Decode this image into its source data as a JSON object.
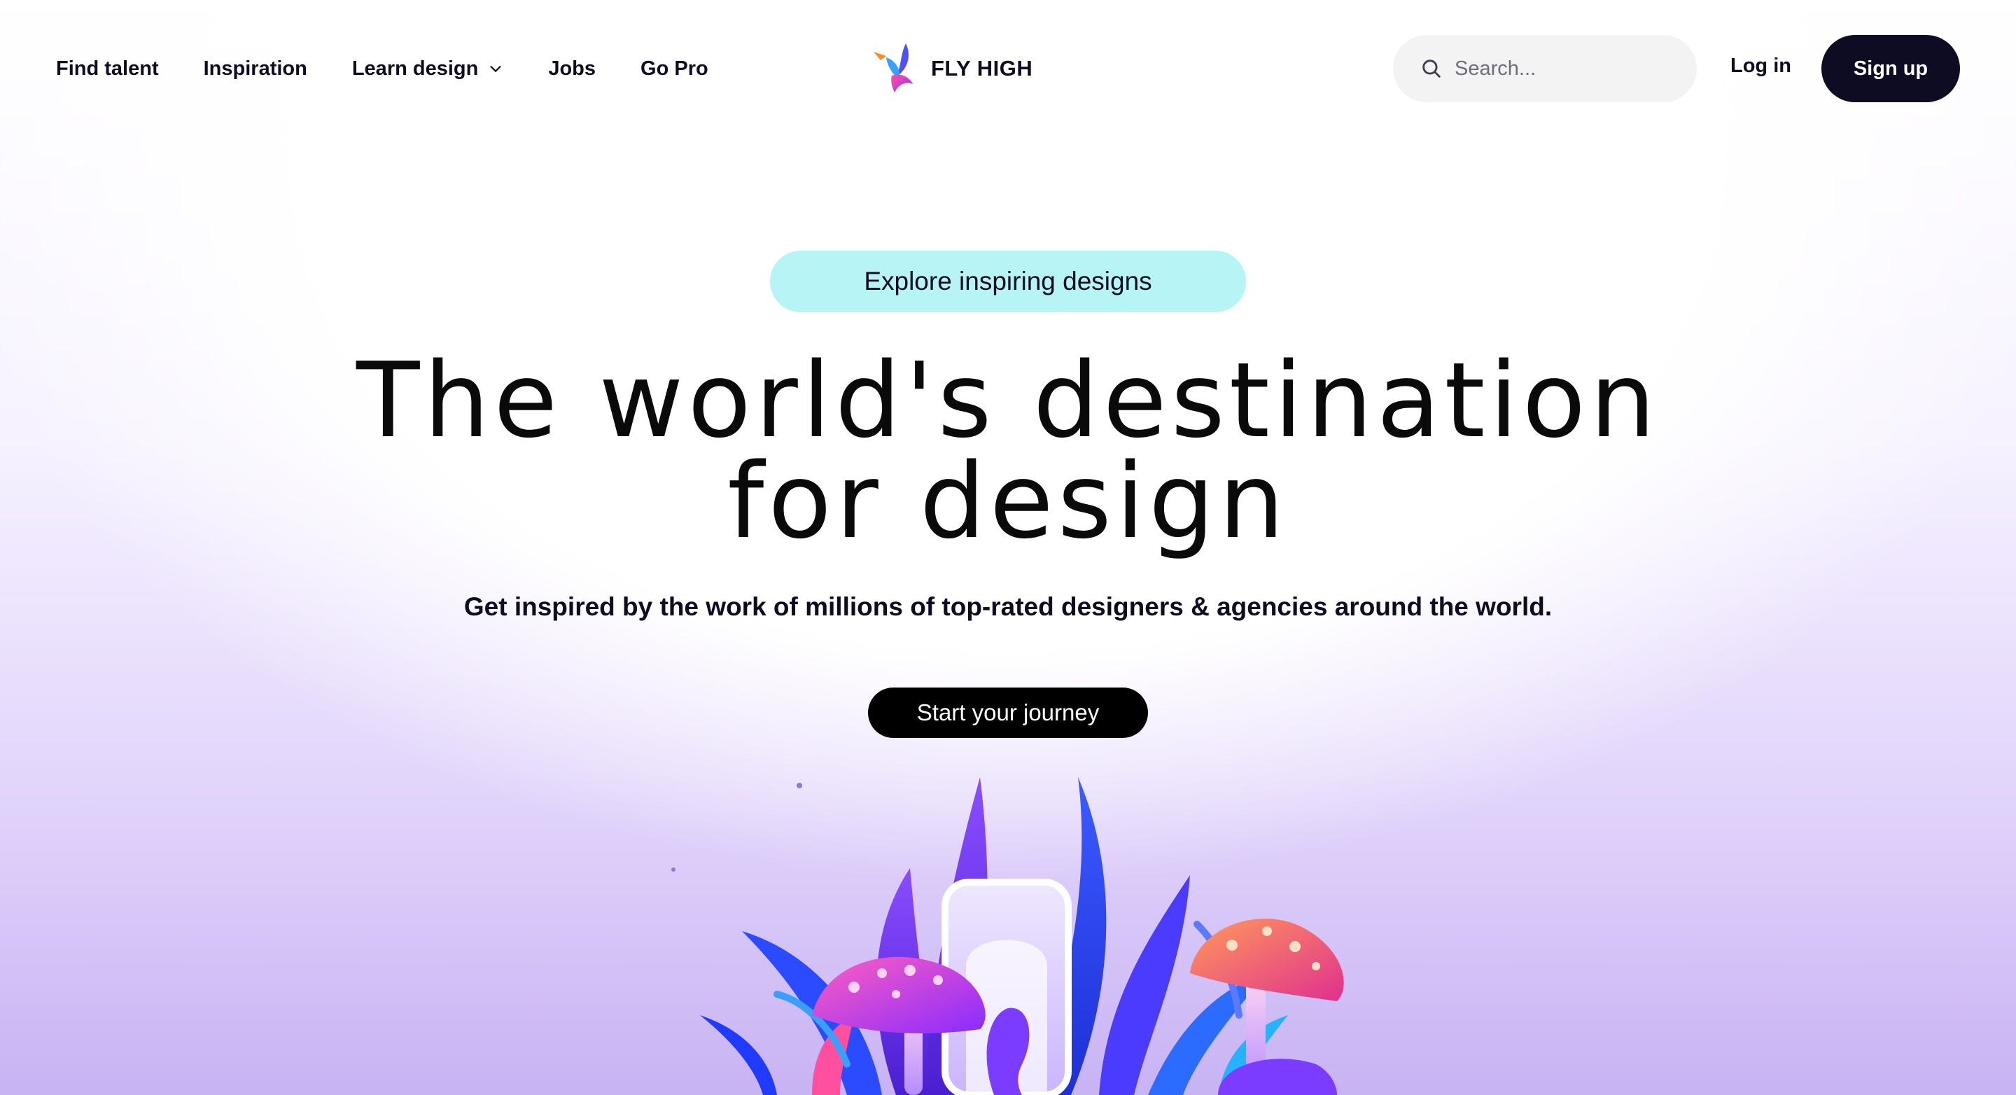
{
  "nav": {
    "items": [
      {
        "label": "Find talent"
      },
      {
        "label": "Inspiration"
      },
      {
        "label": "Learn design",
        "has_dropdown": true
      },
      {
        "label": "Jobs"
      },
      {
        "label": "Go Pro"
      }
    ]
  },
  "brand": {
    "name": "FLY HIGH",
    "icon": "bird-logo-icon"
  },
  "search": {
    "placeholder": "Search...",
    "value": "",
    "icon": "search-icon"
  },
  "auth": {
    "login_label": "Log in",
    "signup_label": "Sign up"
  },
  "hero": {
    "pill_label": "Explore inspiring designs",
    "headline_line1": "The world's destination",
    "headline_line2": "for design",
    "subtitle": "Get inspired by the work of millions of top-rated designers & agencies around the world.",
    "cta_label": "Start your journey"
  },
  "colors": {
    "primary_dark": "#0d0c22",
    "pill_bg": "#b6f4f5",
    "search_bg": "#f3f3f4",
    "gradient_purple": "#c8b3f3"
  }
}
